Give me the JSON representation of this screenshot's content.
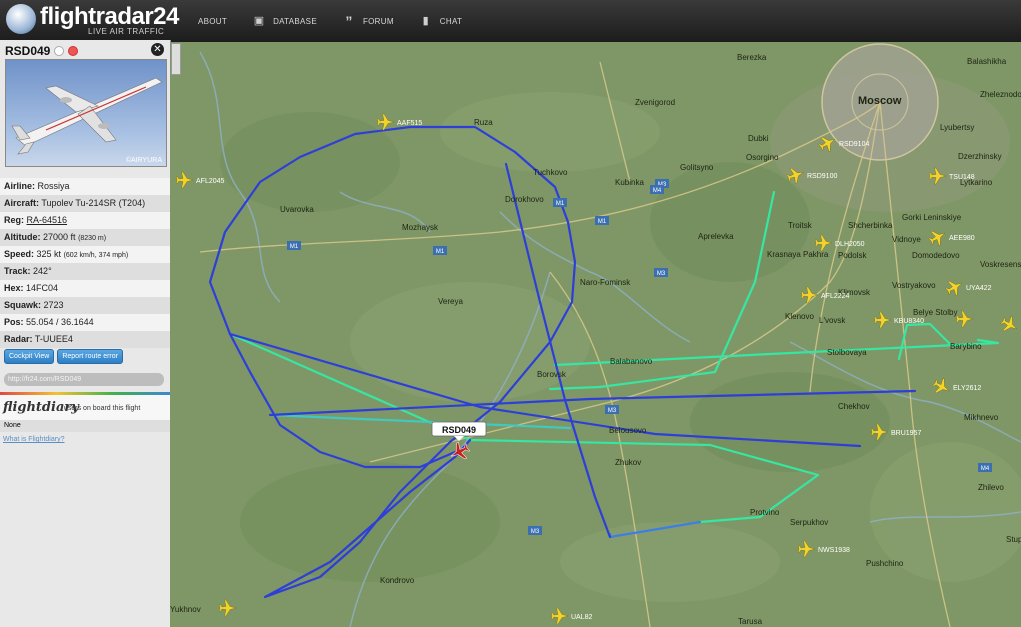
{
  "app": {
    "logo_text": "flightradar24",
    "logo_sub": "LIVE AIR TRAFFIC",
    "nav": [
      {
        "label": "ABOUT",
        "icon": "info-icon"
      },
      {
        "label": "DATABASE",
        "icon": "box-icon"
      },
      {
        "label": "FORUM",
        "icon": "quote-icon"
      },
      {
        "label": "CHAT",
        "icon": "chat-bubble-icon"
      }
    ]
  },
  "flight": {
    "callsign": "RSD049",
    "photo_credit": "©AIRYURA",
    "airline_label": "Airline:",
    "airline": "Rossiya",
    "aircraft_label": "Aircraft:",
    "aircraft": "Tupolev Tu-214SR (T204)",
    "reg_label": "Reg:",
    "reg": "RA-64516",
    "altitude_label": "Altitude:",
    "altitude": "27000 ft",
    "altitude_m": "(8230 m)",
    "speed_label": "Speed:",
    "speed": "325 kt",
    "speed_alt": "(602 km/h, 374 mph)",
    "track_label": "Track:",
    "track": "242°",
    "hex_label": "Hex:",
    "hex": "14FC04",
    "squawk_label": "Squawk:",
    "squawk": "2723",
    "pos_label": "Pos:",
    "pos": "55.054 / 36.1644",
    "radar_label": "Radar:",
    "radar": "T-UUEE4",
    "btn_cockpit": "Cockpit View",
    "btn_report": "Report route error",
    "shortlink": "http://fr24.com/RSD049",
    "flightdiary_logo": "flightdiary",
    "flightdiary_text": "users on board this flight",
    "none_text": "None",
    "whatis_text": "What is Flightdiary?"
  },
  "map": {
    "towns": [
      {
        "name": "Moscow"
      },
      {
        "name": "Berezka"
      },
      {
        "name": "Balashikha"
      },
      {
        "name": "Zheleznodorozhny"
      },
      {
        "name": "Lyubertsy"
      },
      {
        "name": "Dzerzhinsky"
      },
      {
        "name": "Lytkarino"
      },
      {
        "name": "Zvenigorod"
      },
      {
        "name": "Ruza"
      },
      {
        "name": "Tuchkovo"
      },
      {
        "name": "Dubki"
      },
      {
        "name": "Osorgino"
      },
      {
        "name": "Golitsyno"
      },
      {
        "name": "Kubinka"
      },
      {
        "name": "Dorokhovo"
      },
      {
        "name": "Uvarovka"
      },
      {
        "name": "Mozhaysk"
      },
      {
        "name": "Aprelevka"
      },
      {
        "name": "Troitsk"
      },
      {
        "name": "Vidnoye"
      },
      {
        "name": "Shcherbinka"
      },
      {
        "name": "Gorki Leninskiye"
      },
      {
        "name": "Podolsk"
      },
      {
        "name": "Domodedovo"
      },
      {
        "name": "Krasnaya Pakhra"
      },
      {
        "name": "Vereya"
      },
      {
        "name": "Naro-Fominsk"
      },
      {
        "name": "Klimovsk"
      },
      {
        "name": "Klenovo"
      },
      {
        "name": "L'vovsk"
      },
      {
        "name": "Vostryakovo"
      },
      {
        "name": "Voskresensk"
      },
      {
        "name": "Belye Stolby"
      },
      {
        "name": "Barybino"
      },
      {
        "name": "Stolbovaya"
      },
      {
        "name": "Borovsk"
      },
      {
        "name": "Balabanovo"
      },
      {
        "name": "Chekhov"
      },
      {
        "name": "Belousovo"
      },
      {
        "name": "Mikhnevo"
      },
      {
        "name": "Zhukov"
      },
      {
        "name": "Zhilevo"
      },
      {
        "name": "Serpukhov"
      },
      {
        "name": "Protvino"
      },
      {
        "name": "Pushchino"
      },
      {
        "name": "Stupino"
      },
      {
        "name": "Kondrovo"
      },
      {
        "name": "Tarusa"
      },
      {
        "name": "Yukhnov"
      }
    ],
    "roads": [
      "M1",
      "M1",
      "M1",
      "M1",
      "M3",
      "M3",
      "M3",
      "M3",
      "M4",
      "M4"
    ],
    "aircraft": [
      {
        "label": "AAF515"
      },
      {
        "label": "AFL2045"
      },
      {
        "label": "RSD9104"
      },
      {
        "label": "RSD9100"
      },
      {
        "label": "TSU148"
      },
      {
        "label": "DLH2050"
      },
      {
        "label": "AEE980"
      },
      {
        "label": "UYA422"
      },
      {
        "label": "AFL2224"
      },
      {
        "label": "KBU8340"
      },
      {
        "label": "ELY2612"
      },
      {
        "label": "BRU1957"
      },
      {
        "label": "NWS1938"
      },
      {
        "label": "UAL82"
      }
    ],
    "selected_label": "RSD049",
    "colors": {
      "track_blue": "#2d3fd8",
      "track_green": "#36e6a2",
      "map_green": "#7f9766"
    }
  }
}
